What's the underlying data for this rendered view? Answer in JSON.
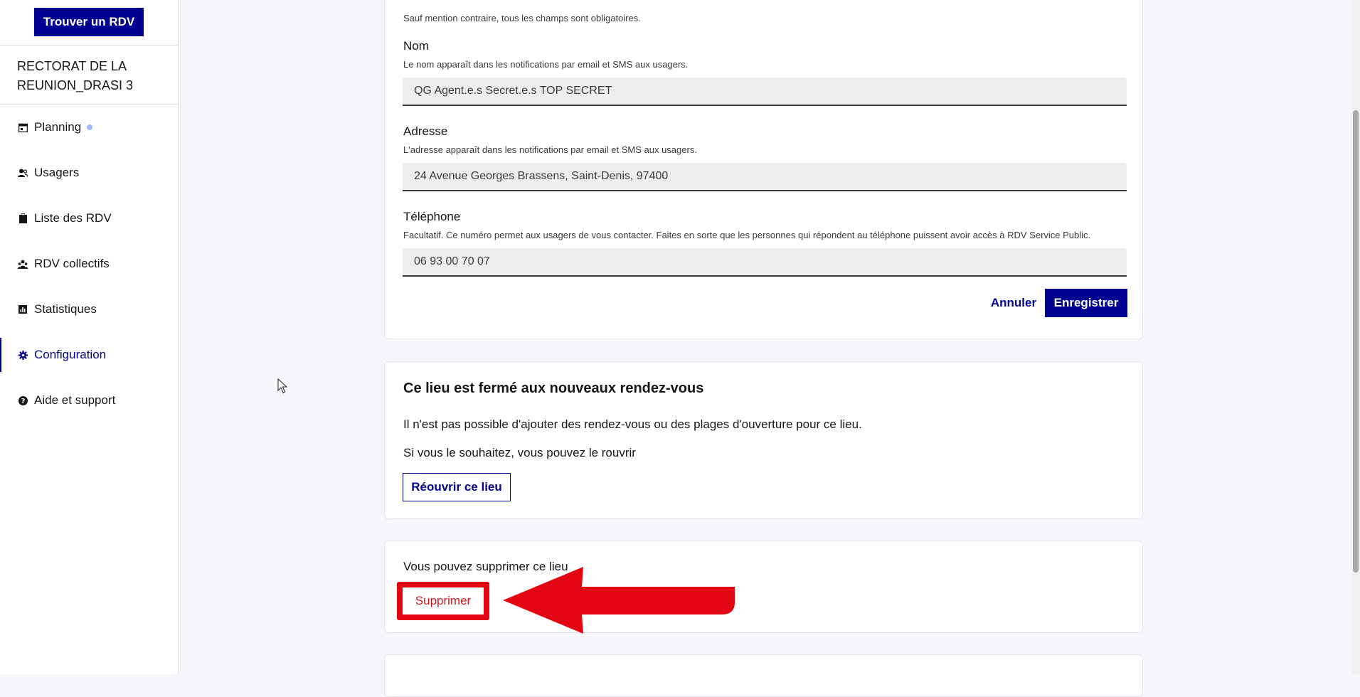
{
  "sidebar": {
    "cta_label": "Trouver un RDV",
    "organization": "RECTORAT DE LA REUNION_DRASI 3",
    "items": [
      {
        "label": "Planning",
        "icon": "calendar-icon"
      },
      {
        "label": "Usagers",
        "icon": "users-icon"
      },
      {
        "label": "Liste des RDV",
        "icon": "clipboard-icon"
      },
      {
        "label": "RDV collectifs",
        "icon": "group-icon"
      },
      {
        "label": "Statistiques",
        "icon": "bar-chart-icon"
      },
      {
        "label": "Configuration",
        "icon": "gear-icon"
      },
      {
        "label": "Aide et support",
        "icon": "question-icon"
      }
    ]
  },
  "form": {
    "required_hint": "Sauf mention contraire, tous les champs sont obligatoires.",
    "name": {
      "label": "Nom",
      "hint": "Le nom apparaît dans les notifications par email et SMS aux usagers.",
      "value": "QG Agent.e.s Secret.e.s TOP SECRET"
    },
    "address": {
      "label": "Adresse",
      "hint": "L'adresse apparaît dans les notifications par email et SMS aux usagers.",
      "value": "24 Avenue Georges Brassens, Saint-Denis, 97400"
    },
    "phone": {
      "label": "Téléphone",
      "hint": "Facultatif. Ce numéro permet aux usagers de vous contacter. Faites en sorte que les personnes qui répondent au téléphone puissent avoir accès à RDV Service Public.",
      "value": "06 93 00 70 07"
    },
    "cancel_label": "Annuler",
    "save_label": "Enregistrer"
  },
  "closed_card": {
    "title": "Ce lieu est fermé aux nouveaux rendez-vous",
    "text1": "Il n'est pas possible d'ajouter des rendez-vous ou des plages d'ouverture pour ce lieu.",
    "text2": "Si vous le souhaitez, vous pouvez le rouvrir",
    "reopen_label": "Réouvrir ce lieu"
  },
  "delete_card": {
    "text": "Vous pouvez supprimer ce lieu",
    "delete_label": "Supprimer"
  },
  "colors": {
    "primary": "#000091",
    "annotation_red": "#e30613"
  }
}
